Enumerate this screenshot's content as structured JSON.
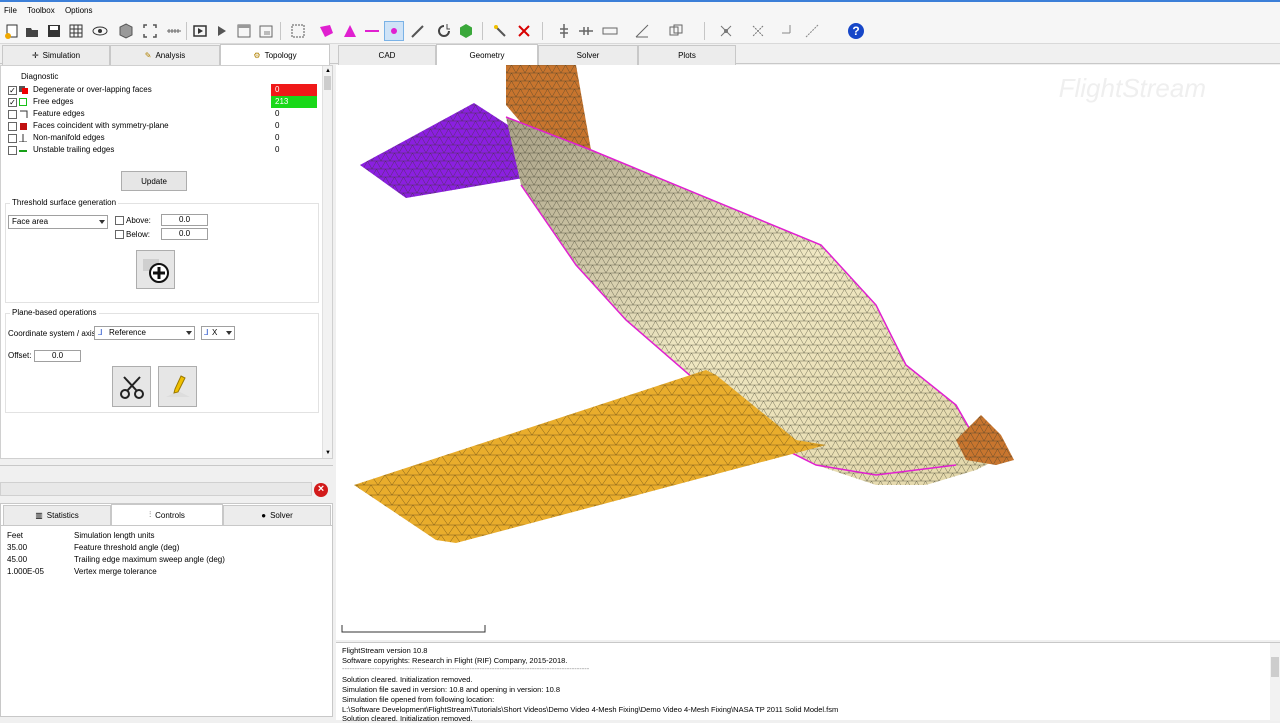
{
  "menu": {
    "file": "File",
    "toolbox": "Toolbox",
    "options": "Options"
  },
  "left_tabs": [
    {
      "label": "Simulation"
    },
    {
      "label": "Analysis"
    },
    {
      "label": "Topology"
    }
  ],
  "right_tabs": [
    {
      "label": "CAD"
    },
    {
      "label": "Geometry"
    },
    {
      "label": "Solver"
    },
    {
      "label": "Plots"
    }
  ],
  "diagnostic": {
    "title": "Diagnostic",
    "rows": [
      {
        "label": "Degenerate or over-lapping faces",
        "value": "0",
        "checked": true
      },
      {
        "label": "Free edges",
        "value": "213",
        "checked": true
      },
      {
        "label": "Feature edges",
        "value": "0",
        "checked": false
      },
      {
        "label": "Faces coincident with symmetry-plane",
        "value": "0",
        "checked": false
      },
      {
        "label": "Non-manifold edges",
        "value": "0",
        "checked": false
      },
      {
        "label": "Unstable trailing edges",
        "value": "0",
        "checked": false
      }
    ],
    "update_label": "Update"
  },
  "threshold": {
    "title": "Threshold surface generation",
    "select": "Face area",
    "above_label": "Above:",
    "above_value": "0.0",
    "below_label": "Below:",
    "below_value": "0.0"
  },
  "plane": {
    "title": "Plane-based operations",
    "coord_label": "Coordinate system / axis:",
    "coord_value": "Reference",
    "axis_value": "X",
    "offset_label": "Offset:",
    "offset_value": "0.0"
  },
  "bottom_tabs": [
    {
      "label": "Statistics"
    },
    {
      "label": "Controls"
    },
    {
      "label": "Solver"
    }
  ],
  "controls": [
    {
      "value": "Feet",
      "desc": "Simulation length units"
    },
    {
      "value": "35.00",
      "desc": "Feature threshold angle (deg)"
    },
    {
      "value": "45.00",
      "desc": "Trailing edge maximum sweep angle (deg)"
    },
    {
      "value": "1.000E-05",
      "desc": "Vertex merge tolerance"
    }
  ],
  "watermark": "FlightStream",
  "console": [
    "FlightStream version 10.8",
    "Software copyrights: Research in Flight (RIF) Company, 2015-2018.",
    "---------------------------------------------------------------------------------------------------",
    "Solution cleared. Initialization removed.",
    "Simulation file saved in version: 10.8 and opening in version: 10.8",
    "Simulation file opened from following location:",
    "L:\\Software Development\\FlightStream\\Tutorials\\Short Videos\\Demo Video 4-Mesh Fixing\\Demo Video 4-Mesh Fixing\\NASA TP 2011 Solid Model.fsm",
    "Solution cleared. Initialization removed."
  ],
  "colors": {
    "red_flag": "#f01818",
    "green_flag": "#18d818",
    "fuselage": "#efe7c2",
    "wing": "#e9ad2c",
    "htail": "#8b1fe0",
    "vtail": "#c8752e",
    "free_edge": "#e020d0"
  },
  "icons": [
    "new-icon",
    "open-icon",
    "save-icon",
    "grid-icon",
    "eye-icon",
    "cube-icon",
    "fit-icon",
    "ruler-icon",
    "record-icon",
    "play-icon",
    "window-icon",
    "select-icon",
    "pink-shape-icon",
    "triangle-icon",
    "line-icon",
    "point-icon",
    "pen-icon",
    "refresh-icon",
    "hexagon-icon",
    "wand-icon",
    "delete-icon",
    "help-icon"
  ]
}
